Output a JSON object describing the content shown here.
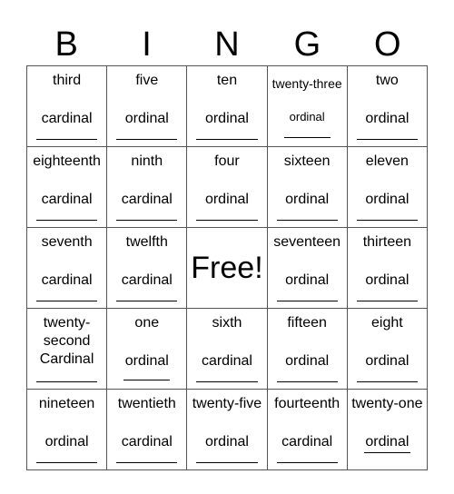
{
  "header": [
    "B",
    "I",
    "N",
    "G",
    "O"
  ],
  "cells": [
    [
      {
        "word": "third",
        "type": "cardinal"
      },
      {
        "word": "five",
        "type": "ordinal"
      },
      {
        "word": "ten",
        "type": "ordinal"
      },
      {
        "word": "twenty-three",
        "type": "ordinal"
      },
      {
        "word": "two",
        "type": "ordinal"
      }
    ],
    [
      {
        "word": "eighteenth",
        "type": "cardinal"
      },
      {
        "word": "ninth",
        "type": "cardinal"
      },
      {
        "word": "four",
        "type": "ordinal"
      },
      {
        "word": "sixteen",
        "type": "ordinal"
      },
      {
        "word": "eleven",
        "type": "ordinal"
      }
    ],
    [
      {
        "word": "seventh",
        "type": "cardinal"
      },
      {
        "word": "twelfth",
        "type": "cardinal"
      },
      {
        "free": "Free!"
      },
      {
        "word": "seventeen",
        "type": "ordinal"
      },
      {
        "word": "thirteen",
        "type": "ordinal"
      }
    ],
    [
      {
        "word": "twenty-second Cardinal",
        "line1": "twenty-",
        "line2": "second",
        "line3": "Cardinal"
      },
      {
        "word": "one",
        "type": "ordinal"
      },
      {
        "word": "sixth",
        "type": "cardinal"
      },
      {
        "word": "fifteen",
        "type": "ordinal"
      },
      {
        "word": "eight",
        "type": "ordinal"
      }
    ],
    [
      {
        "word": "nineteen",
        "type": "ordinal"
      },
      {
        "word": "twentieth",
        "type": "cardinal"
      },
      {
        "word": "twenty-five",
        "type": "ordinal"
      },
      {
        "word": "fourteenth",
        "type": "cardinal"
      },
      {
        "word": "twenty-one",
        "type": "ordinal"
      }
    ]
  ]
}
